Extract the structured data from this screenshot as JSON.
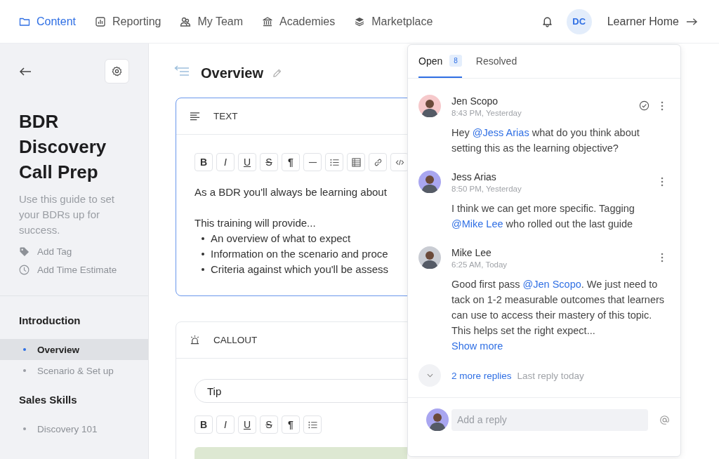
{
  "nav": {
    "items": [
      {
        "label": "Content",
        "selected": true
      },
      {
        "label": "Reporting",
        "selected": false
      },
      {
        "label": "My Team",
        "selected": false
      },
      {
        "label": "Academies",
        "selected": false
      },
      {
        "label": "Marketplace",
        "selected": false
      }
    ],
    "user_initials": "DC",
    "learner_home": "Learner Home"
  },
  "sidebar": {
    "title": "BDR Discovery Call Prep",
    "description": "Use this guide to set your BDRs up for success.",
    "actions": [
      {
        "label": "Add Tag",
        "kind": "tag"
      },
      {
        "label": "Add Time Estimate",
        "kind": "time"
      }
    ],
    "sections": [
      {
        "title": "Introduction",
        "items": [
          {
            "label": "Overview",
            "selected": true
          },
          {
            "label": "Scenario & Set up",
            "selected": false
          }
        ]
      },
      {
        "title": "Sales Skills",
        "items": [
          {
            "label": "Discovery 101",
            "selected": false
          }
        ]
      }
    ]
  },
  "page": {
    "title": "Overview"
  },
  "blocks": [
    {
      "kind": "text",
      "label": "TEXT",
      "toolbar": [
        {
          "kind": "bold",
          "text": "B"
        },
        {
          "kind": "italic",
          "text": "I"
        },
        {
          "kind": "underline",
          "text": "U"
        },
        {
          "kind": "strike",
          "text": "S"
        },
        {
          "kind": "pilcrow",
          "text": "¶"
        },
        {
          "kind": "rule"
        },
        {
          "kind": "list"
        },
        {
          "kind": "table"
        },
        {
          "kind": "link"
        },
        {
          "kind": "code"
        }
      ],
      "lead": "As a BDR you'll always be learning about",
      "intro": "This training will provide...",
      "bullets": [
        "An overview of what to expect",
        "Information on the scenario and proce",
        "Criteria against which you'll be assess"
      ]
    },
    {
      "kind": "callout",
      "label": "CALLOUT",
      "field_value": "Tip",
      "toolbar": [
        {
          "kind": "bold",
          "text": "B"
        },
        {
          "kind": "italic",
          "text": "I"
        },
        {
          "kind": "underline",
          "text": "U"
        },
        {
          "kind": "strike",
          "text": "S"
        },
        {
          "kind": "pilcrow",
          "text": "¶"
        },
        {
          "kind": "list"
        }
      ]
    }
  ],
  "panel": {
    "tabs": [
      {
        "label": "Open",
        "count": "8",
        "selected": true
      },
      {
        "label": "Resolved",
        "selected": false
      }
    ],
    "comments": [
      {
        "author": "Jen Scopo",
        "time": "8:43 PM, Yesterday",
        "color": "#f6c9cb",
        "resolvable": true,
        "parts": [
          {
            "text": "Hey "
          },
          {
            "mention": "@Jess Arias"
          },
          {
            "text": " what do you think about setting this as the learning objective?"
          }
        ]
      },
      {
        "author": "Jess Arias",
        "time": "8:50 PM, Yesterday",
        "color": "#a9a6f0",
        "resolvable": false,
        "parts": [
          {
            "text": "I think we can get more specific. Tagging "
          },
          {
            "mention": "@Mike Lee"
          },
          {
            "text": " who rolled out the last guide"
          }
        ]
      },
      {
        "author": "Mike Lee",
        "time": "6:25 AM, Today",
        "color": "#c9ccd3",
        "resolvable": false,
        "parts": [
          {
            "text": "Good first pass "
          },
          {
            "mention": "@Jen Scopo"
          },
          {
            "text": ". We just need to tack on 1-2 measurable outcomes that learners can use to access their mastery of this topic. This helps set the right expect..."
          }
        ],
        "show_more": "Show more"
      }
    ],
    "more_replies": "2 more replies",
    "last_reply": "Last reply today",
    "reply_placeholder": "Add a reply"
  }
}
